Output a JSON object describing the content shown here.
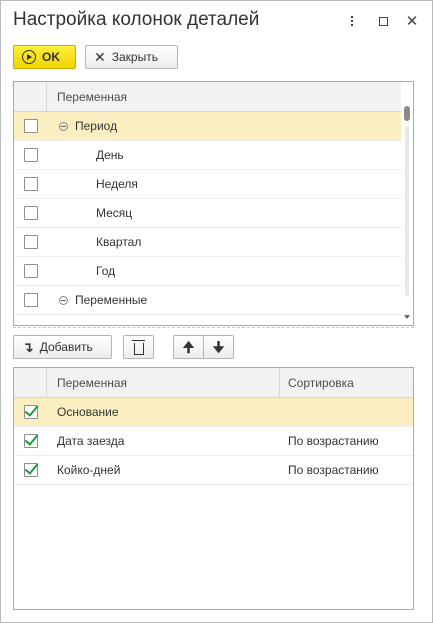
{
  "window": {
    "title": "Настройка колонок деталей",
    "more_icon": "more-vertical-icon",
    "maximize_icon": "maximize-icon",
    "close_icon": "close-icon"
  },
  "toolbar": {
    "ok_label": "OK",
    "close_label": "Закрыть"
  },
  "available_table": {
    "header": "Переменная",
    "rows": [
      {
        "label": "Период",
        "checked": false,
        "group": true,
        "selected": true
      },
      {
        "label": "День",
        "checked": false,
        "group": false,
        "selected": false
      },
      {
        "label": "Неделя",
        "checked": false,
        "group": false,
        "selected": false
      },
      {
        "label": "Месяц",
        "checked": false,
        "group": false,
        "selected": false
      },
      {
        "label": "Квартал",
        "checked": false,
        "group": false,
        "selected": false
      },
      {
        "label": "Год",
        "checked": false,
        "group": false,
        "selected": false
      },
      {
        "label": "Переменные",
        "checked": false,
        "group": true,
        "selected": false
      }
    ]
  },
  "edit_toolbar": {
    "add_label": "Добавить",
    "delete_icon": "trash-icon",
    "up_icon": "arrow-up-icon",
    "down_icon": "arrow-down-icon"
  },
  "selected_table": {
    "header_var": "Переменная",
    "header_sort": "Сортировка",
    "rows": [
      {
        "label": "Основание",
        "sort": "",
        "checked": true,
        "selected": true
      },
      {
        "label": "Дата заезда",
        "sort": "По возрастанию",
        "checked": true,
        "selected": false
      },
      {
        "label": "Койко-дней",
        "sort": "По возрастанию",
        "checked": true,
        "selected": false
      }
    ]
  },
  "colors": {
    "accent": "#f5dc00",
    "selection": "#fbeec0",
    "check": "#1e9a38"
  }
}
